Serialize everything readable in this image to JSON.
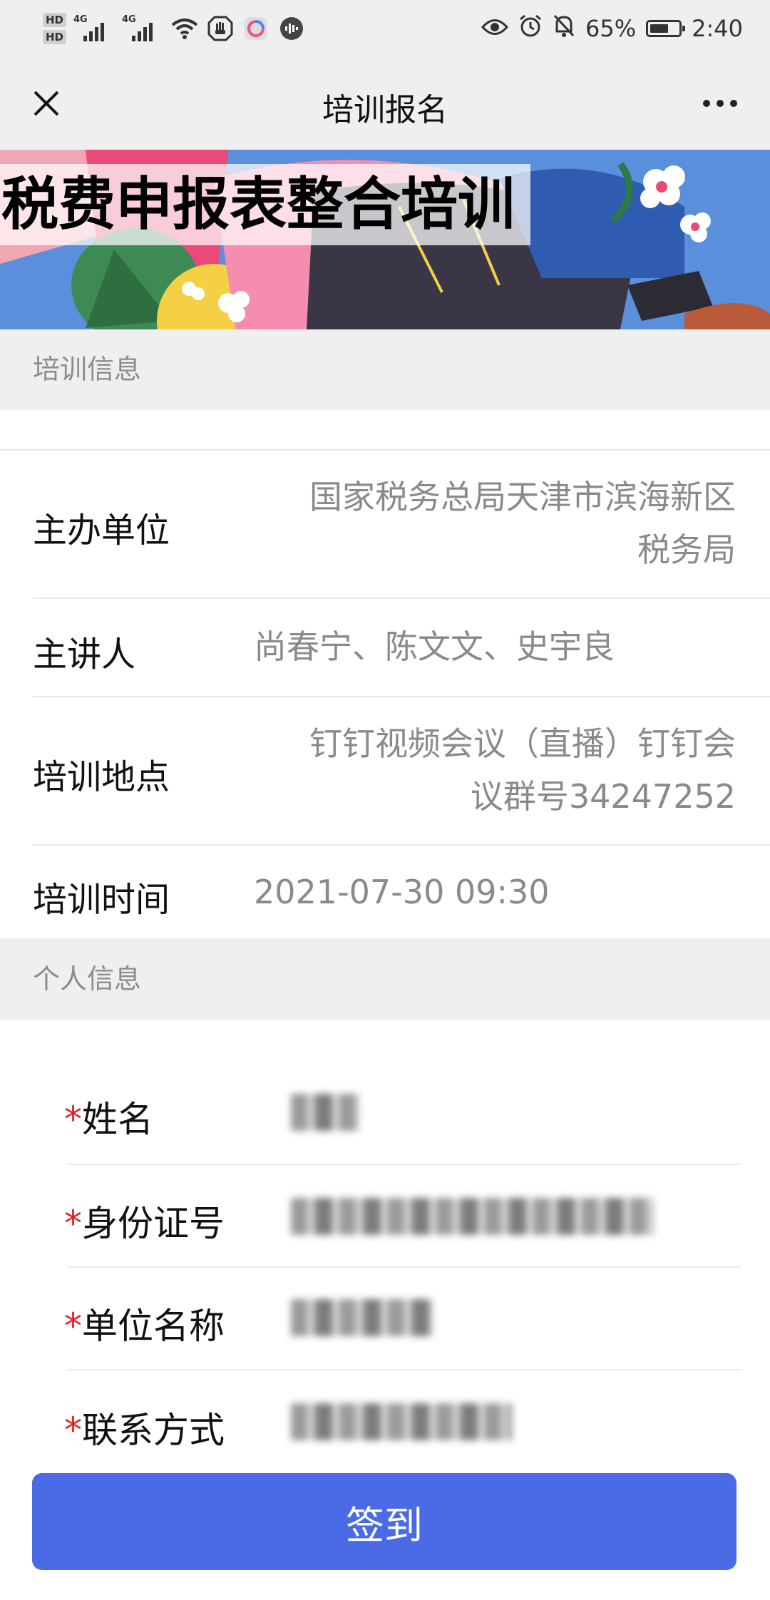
{
  "status_bar": {
    "hd1": "HD",
    "hd2": "HD",
    "signal1_label": "4G",
    "signal2_label": "4G",
    "battery_percent": "65%",
    "battery_level": 0.65,
    "time": "2:40",
    "icons": [
      "wifi-icon",
      "hand-icon",
      "browser-icon",
      "voice-icon",
      "eye-icon",
      "alarm-icon",
      "mute-bell-icon",
      "battery-icon"
    ]
  },
  "header": {
    "title": "培训报名",
    "close_icon": "close-icon",
    "more_icon": "more-icon"
  },
  "banner": {
    "title": "税费申报表整合培训"
  },
  "training_section": {
    "title": "培训信息",
    "rows": [
      {
        "label": "主办单位",
        "value_line1": "国家税务总局天津市滨海新区",
        "value_line2": "税务局"
      },
      {
        "label": "主讲人",
        "value": "尚春宁、陈文文、史宇良"
      },
      {
        "label": "培训地点",
        "value_line1": "钉钉视频会议（直播）钉钉会",
        "value_line2": "议群号34247252"
      },
      {
        "label": "培训时间",
        "value": "2021-07-30 09:30"
      }
    ]
  },
  "personal_section": {
    "title": "个人信息",
    "required_mark": "*",
    "fields": [
      {
        "label": "姓名"
      },
      {
        "label": "身份证号"
      },
      {
        "label": "单位名称"
      },
      {
        "label": "联系方式"
      }
    ]
  },
  "submit": {
    "label": "签到"
  },
  "colors": {
    "accent": "#4a6ae6",
    "required": "#e02020",
    "section_bg": "#efefef",
    "muted_text": "#8a8a8a"
  }
}
